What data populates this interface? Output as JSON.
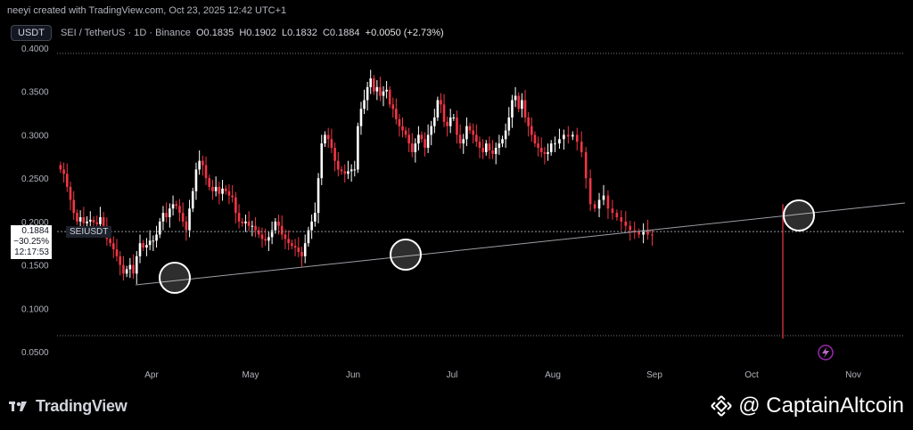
{
  "header": {
    "credit": "neeyi created with TradingView.com, Oct 23, 2025 12:42 UTC+1"
  },
  "legend": {
    "currency": "USDT",
    "symbol_line": "SEI / TetherUS · 1D · Binance",
    "open": "O0.1835",
    "high": "H0.1902",
    "low": "L0.1832",
    "close": "C0.1884",
    "change": "+0.0050 (+2.73%)"
  },
  "price_tag": {
    "price": "0.1884",
    "change_pct": "−30.25%",
    "countdown": "12:17:53",
    "symbol": "SEIUSDT"
  },
  "footer": {
    "tv_brand": "TradingView",
    "author_brand": "@ CaptainAltcoin"
  },
  "colors": {
    "up": "#ffffff",
    "down": "#f23645",
    "trendline": "#9e9ea6",
    "background": "#000000"
  },
  "icons": [
    "tradingview-logo-icon",
    "binance-logo-icon",
    "lightning-icon"
  ],
  "chart_data": {
    "type": "candlestick",
    "y_ticks": [
      "0.0500",
      "0.1000",
      "0.1500",
      "0.2000",
      "0.2500",
      "0.3000",
      "0.3500",
      "0.4000"
    ],
    "x_labels": [
      "Apr",
      "May",
      "Jun",
      "Jul",
      "Aug",
      "Sep",
      "Oct",
      "Nov"
    ],
    "ylim": [
      0.05,
      0.4
    ],
    "current_price": 0.1884,
    "annotations": [
      "rising trendline",
      "circled touches near Apr, mid-Jun and mid-Oct"
    ],
    "close_path": [
      [
        0.26,
        0.255,
        0.24,
        0.225,
        0.21,
        0.2,
        0.205,
        0.198,
        0.2,
        0.202,
        0.199,
        0.197,
        0.205,
        0.195,
        0.18,
        0.175,
        0.168,
        0.16,
        0.15,
        0.14,
        0.145,
        0.15,
        0.14,
        0.16,
        0.175,
        0.17,
        0.173,
        0.178
      ],
      [
        0.178,
        0.185,
        0.2,
        0.21,
        0.205,
        0.215,
        0.22,
        0.218,
        0.21,
        0.2,
        0.19,
        0.215,
        0.235,
        0.26,
        0.27,
        0.265,
        0.25,
        0.24,
        0.235,
        0.24,
        0.232,
        0.238,
        0.235,
        0.23,
        0.228,
        0.21,
        0.2,
        0.198,
        0.2,
        0.195
      ],
      [
        0.195,
        0.19,
        0.185,
        0.18,
        0.178,
        0.182,
        0.19,
        0.2,
        0.195,
        0.185,
        0.18,
        0.175,
        0.172,
        0.17,
        0.165,
        0.16,
        0.175,
        0.19,
        0.2,
        0.21,
        0.25,
        0.29,
        0.3,
        0.295,
        0.285,
        0.27,
        0.26,
        0.258,
        0.255,
        0.258,
        0.26
      ],
      [
        0.26,
        0.31,
        0.33,
        0.34,
        0.355,
        0.365,
        0.35,
        0.355,
        0.345,
        0.35,
        0.352,
        0.335,
        0.33,
        0.318,
        0.31,
        0.305,
        0.3,
        0.29,
        0.28,
        0.29,
        0.3,
        0.295,
        0.285,
        0.3,
        0.31,
        0.32,
        0.34,
        0.335,
        0.315,
        0.31,
        0.32
      ],
      [
        0.32,
        0.3,
        0.29,
        0.295,
        0.31,
        0.305,
        0.3,
        0.292,
        0.285,
        0.28,
        0.29,
        0.282,
        0.278,
        0.285,
        0.29,
        0.295,
        0.305,
        0.32,
        0.34,
        0.345,
        0.33,
        0.34,
        0.32,
        0.31,
        0.3,
        0.29,
        0.285,
        0.28,
        0.278,
        0.28,
        0.29
      ],
      [
        0.29,
        0.295,
        0.3,
        0.298,
        0.3,
        0.292,
        0.28,
        0.25,
        0.22,
        0.215,
        0.225,
        0.23,
        0.215,
        0.21,
        0.205,
        0.2,
        0.195,
        0.19,
        0.188,
        0.185,
        0.19,
        0.185,
        0.184
      ]
    ],
    "wick_low_outlier": 0.065
  }
}
